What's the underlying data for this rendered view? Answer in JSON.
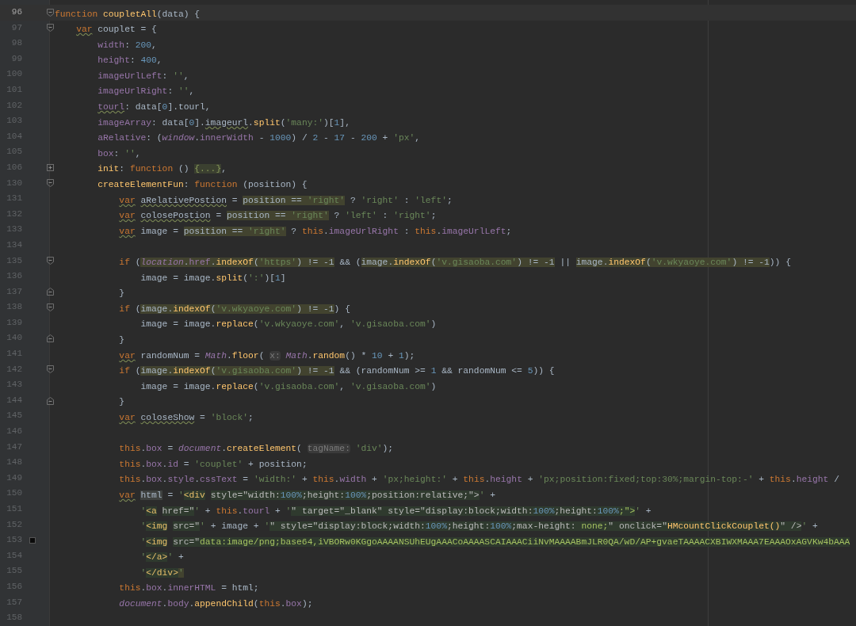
{
  "editor": {
    "lines": [
      {
        "number": "96",
        "current": true,
        "bookmark": false,
        "kind": "opener",
        "segments": [
          {
            "text": "function ",
            "kind": "keyword"
          },
          {
            "text": "coupletAll",
            "kind": "function"
          },
          {
            "text": "(data) {",
            "kind": "plain"
          }
        ]
      },
      {
        "number": "97",
        "current": false,
        "bookmark": false,
        "kind": "opener",
        "segments": [
          {
            "kind": "typo",
            "segments": [
              {
                "text": "    var",
                "kind": "keyword"
              }
            ]
          },
          {
            "text": " couplet = {",
            "kind": "plain"
          }
        ]
      },
      {
        "number": "98",
        "current": false,
        "bookmark": false,
        "segments": [
          {
            "text": "        width",
            "kind": "field"
          },
          {
            "text": ": ",
            "kind": "plain"
          },
          {
            "text": "200",
            "kind": "number"
          },
          {
            "text": ",",
            "kind": "plain"
          }
        ]
      },
      {
        "number": "99",
        "current": false,
        "bookmark": false,
        "segments": [
          {
            "text": "        height",
            "kind": "field"
          },
          {
            "text": ": ",
            "kind": "plain"
          },
          {
            "text": "400",
            "kind": "number"
          },
          {
            "text": ",",
            "kind": "plain"
          }
        ]
      },
      {
        "number": "100",
        "current": false,
        "bookmark": false,
        "segments": [
          {
            "text": "        imageUrlLeft",
            "kind": "field"
          },
          {
            "text": ": ",
            "kind": "plain"
          },
          {
            "text": "''",
            "kind": "string"
          },
          {
            "text": ",",
            "kind": "plain"
          }
        ]
      },
      {
        "number": "101",
        "current": false,
        "bookmark": false,
        "segments": [
          {
            "text": "        imageUrlRight",
            "kind": "field"
          },
          {
            "text": ": ",
            "kind": "plain"
          },
          {
            "text": "''",
            "kind": "string"
          },
          {
            "text": ",",
            "kind": "plain"
          }
        ]
      },
      {
        "number": "102",
        "current": false,
        "bookmark": false,
        "segments": [
          {
            "kind": "typo",
            "segments": [
              {
                "text": "        tourl",
                "kind": "field"
              }
            ]
          },
          {
            "text": ": data[",
            "kind": "plain"
          },
          {
            "text": "0",
            "kind": "number"
          },
          {
            "text": "].tourl,",
            "kind": "plain"
          }
        ]
      },
      {
        "number": "103",
        "current": false,
        "bookmark": false,
        "segments": [
          {
            "text": "        imageArray",
            "kind": "field"
          },
          {
            "text": ": data[",
            "kind": "plain"
          },
          {
            "text": "0",
            "kind": "number"
          },
          {
            "text": "].",
            "kind": "plain"
          },
          {
            "kind": "typo",
            "segments": [
              {
                "text": "imageurl",
                "kind": "plain"
              }
            ]
          },
          {
            "text": ".",
            "kind": "plain"
          },
          {
            "text": "split",
            "kind": "function"
          },
          {
            "text": "(",
            "kind": "plain"
          },
          {
            "text": "'many:'",
            "kind": "string"
          },
          {
            "text": ")[",
            "kind": "plain"
          },
          {
            "text": "1",
            "kind": "number"
          },
          {
            "text": "],",
            "kind": "plain"
          }
        ]
      },
      {
        "number": "104",
        "current": false,
        "bookmark": false,
        "segments": [
          {
            "text": "        aRelative",
            "kind": "field"
          },
          {
            "text": ": (",
            "kind": "plain"
          },
          {
            "text": "window",
            "kind": "global"
          },
          {
            "text": ".",
            "kind": "plain"
          },
          {
            "text": "innerWidth",
            "kind": "field"
          },
          {
            "text": " - ",
            "kind": "plain"
          },
          {
            "text": "1000",
            "kind": "number"
          },
          {
            "text": ") / ",
            "kind": "plain"
          },
          {
            "text": "2",
            "kind": "number"
          },
          {
            "text": " - ",
            "kind": "plain"
          },
          {
            "text": "17",
            "kind": "number"
          },
          {
            "text": " - ",
            "kind": "plain"
          },
          {
            "text": "200",
            "kind": "number"
          },
          {
            "text": " + ",
            "kind": "plain"
          },
          {
            "text": "'px'",
            "kind": "string"
          },
          {
            "text": ",",
            "kind": "plain"
          }
        ]
      },
      {
        "number": "105",
        "current": false,
        "bookmark": false,
        "segments": [
          {
            "text": "        box",
            "kind": "field"
          },
          {
            "text": ": ",
            "kind": "plain"
          },
          {
            "text": "''",
            "kind": "string"
          },
          {
            "text": ",",
            "kind": "plain"
          }
        ]
      },
      {
        "number": "106",
        "current": false,
        "bookmark": false,
        "kind": "collapsed",
        "segments": [
          {
            "text": "        init",
            "kind": "function"
          },
          {
            "text": ": ",
            "kind": "plain"
          },
          {
            "text": "function",
            "kind": "keyword"
          },
          {
            "text": " () ",
            "kind": "plain"
          },
          {
            "text": "{...}",
            "kind": "folded"
          },
          {
            "text": ",",
            "kind": "plain"
          }
        ]
      },
      {
        "number": "130",
        "current": false,
        "bookmark": false,
        "kind": "opener",
        "segments": [
          {
            "text": "        createElementFun",
            "kind": "function"
          },
          {
            "text": ": ",
            "kind": "plain"
          },
          {
            "text": "function",
            "kind": "keyword"
          },
          {
            "text": " (position) {",
            "kind": "plain"
          }
        ]
      },
      {
        "number": "131",
        "current": false,
        "bookmark": false,
        "segments": [
          {
            "kind": "typo",
            "segments": [
              {
                "text": "            var",
                "kind": "keyword"
              }
            ]
          },
          {
            "kind": "typo",
            "segments": [
              {
                "text": " aRelativePostion",
                "kind": "plain"
              }
            ]
          },
          {
            "text": " = ",
            "kind": "plain"
          },
          {
            "kind": "match",
            "segments": [
              {
                "text": "position == ",
                "kind": "plain"
              },
              {
                "text": "'right'",
                "kind": "string"
              }
            ]
          },
          {
            "text": " ? ",
            "kind": "plain"
          },
          {
            "text": "'right'",
            "kind": "string"
          },
          {
            "text": " : ",
            "kind": "plain"
          },
          {
            "text": "'left'",
            "kind": "string"
          },
          {
            "text": ";",
            "kind": "plain"
          }
        ]
      },
      {
        "number": "132",
        "current": false,
        "bookmark": false,
        "segments": [
          {
            "kind": "typo",
            "segments": [
              {
                "text": "            var",
                "kind": "keyword"
              }
            ]
          },
          {
            "kind": "typo",
            "segments": [
              {
                "text": " colosePostion",
                "kind": "plain"
              }
            ]
          },
          {
            "text": " = ",
            "kind": "plain"
          },
          {
            "kind": "match",
            "segments": [
              {
                "text": "position == ",
                "kind": "plain"
              },
              {
                "text": "'right'",
                "kind": "string"
              }
            ]
          },
          {
            "text": " ? ",
            "kind": "plain"
          },
          {
            "text": "'left'",
            "kind": "string"
          },
          {
            "text": " : ",
            "kind": "plain"
          },
          {
            "text": "'right'",
            "kind": "string"
          },
          {
            "text": ";",
            "kind": "plain"
          }
        ]
      },
      {
        "number": "133",
        "current": false,
        "bookmark": false,
        "segments": [
          {
            "kind": "typo",
            "segments": [
              {
                "text": "            var",
                "kind": "keyword"
              }
            ]
          },
          {
            "text": " image = ",
            "kind": "plain"
          },
          {
            "kind": "match",
            "segments": [
              {
                "text": "position == ",
                "kind": "plain"
              },
              {
                "text": "'right'",
                "kind": "string"
              }
            ]
          },
          {
            "text": " ? ",
            "kind": "plain"
          },
          {
            "text": "this",
            "kind": "keyword"
          },
          {
            "text": ".",
            "kind": "plain"
          },
          {
            "text": "imageUrlRight",
            "kind": "field"
          },
          {
            "text": " : ",
            "kind": "plain"
          },
          {
            "text": "this",
            "kind": "keyword"
          },
          {
            "text": ".",
            "kind": "plain"
          },
          {
            "text": "imageUrlLeft",
            "kind": "field"
          },
          {
            "text": ";",
            "kind": "plain"
          }
        ]
      },
      {
        "number": "134",
        "current": false,
        "bookmark": false
      },
      {
        "number": "135",
        "current": false,
        "bookmark": false,
        "kind": "opener",
        "segments": [
          {
            "text": "            if",
            "kind": "keyword"
          },
          {
            "text": " (",
            "kind": "plain"
          },
          {
            "kind": "match",
            "segments": [
              {
                "text": "location",
                "kind": "global"
              },
              {
                "text": ".",
                "kind": "plain"
              },
              {
                "text": "href",
                "kind": "field"
              },
              {
                "text": ".",
                "kind": "plain"
              },
              {
                "text": "indexOf",
                "kind": "function"
              },
              {
                "text": "(",
                "kind": "plain"
              },
              {
                "text": "'https'",
                "kind": "string"
              },
              {
                "text": ") != -1",
                "kind": "plain"
              }
            ]
          },
          {
            "text": " && (",
            "kind": "plain"
          },
          {
            "kind": "match",
            "segments": [
              {
                "text": "image.",
                "kind": "plain"
              },
              {
                "text": "indexOf",
                "kind": "function"
              },
              {
                "text": "(",
                "kind": "plain"
              },
              {
                "text": "'v.gisaoba.com'",
                "kind": "string"
              },
              {
                "text": ") != -1",
                "kind": "plain"
              }
            ]
          },
          {
            "text": " || ",
            "kind": "plain"
          },
          {
            "kind": "match",
            "segments": [
              {
                "text": "image.",
                "kind": "plain"
              },
              {
                "text": "indexOf",
                "kind": "function"
              },
              {
                "text": "(",
                "kind": "plain"
              },
              {
                "text": "'v.wkyaoye.com'",
                "kind": "string"
              },
              {
                "text": ") != -1",
                "kind": "plain"
              }
            ]
          },
          {
            "text": ")) {",
            "kind": "plain"
          }
        ]
      },
      {
        "number": "136",
        "current": false,
        "bookmark": false,
        "segments": [
          {
            "text": "                image = image.",
            "kind": "plain"
          },
          {
            "text": "split",
            "kind": "function"
          },
          {
            "text": "(",
            "kind": "plain"
          },
          {
            "text": "':'",
            "kind": "string"
          },
          {
            "text": ")[",
            "kind": "plain"
          },
          {
            "text": "1",
            "kind": "number"
          },
          {
            "text": "]",
            "kind": "plain"
          }
        ]
      },
      {
        "number": "137",
        "current": false,
        "bookmark": false,
        "kind": "closer",
        "segments": [
          {
            "text": "            }",
            "kind": "plain"
          }
        ]
      },
      {
        "number": "138",
        "current": false,
        "bookmark": false,
        "kind": "opener",
        "segments": [
          {
            "text": "            if",
            "kind": "keyword"
          },
          {
            "text": " (",
            "kind": "plain"
          },
          {
            "kind": "match",
            "segments": [
              {
                "text": "image.",
                "kind": "plain"
              },
              {
                "text": "indexOf",
                "kind": "function"
              },
              {
                "text": "(",
                "kind": "plain"
              },
              {
                "text": "'v.wkyaoye.com'",
                "kind": "string"
              },
              {
                "text": ") != -1",
                "kind": "plain"
              }
            ]
          },
          {
            "text": ") {",
            "kind": "plain"
          }
        ]
      },
      {
        "number": "139",
        "current": false,
        "bookmark": false,
        "segments": [
          {
            "text": "                image = image.",
            "kind": "plain"
          },
          {
            "text": "replace",
            "kind": "function"
          },
          {
            "text": "(",
            "kind": "plain"
          },
          {
            "text": "'v.wkyaoye.com'",
            "kind": "string"
          },
          {
            "text": ", ",
            "kind": "plain"
          },
          {
            "text": "'v.gisaoba.com'",
            "kind": "string"
          },
          {
            "text": ")",
            "kind": "plain"
          }
        ]
      },
      {
        "number": "140",
        "current": false,
        "bookmark": false,
        "kind": "closer",
        "segments": [
          {
            "text": "            }",
            "kind": "plain"
          }
        ]
      },
      {
        "number": "141",
        "current": false,
        "bookmark": false,
        "segments": [
          {
            "kind": "typo",
            "segments": [
              {
                "text": "            var",
                "kind": "keyword"
              }
            ]
          },
          {
            "text": " randomNum = ",
            "kind": "plain"
          },
          {
            "text": "Math",
            "kind": "global"
          },
          {
            "text": ".",
            "kind": "plain"
          },
          {
            "text": "floor",
            "kind": "function"
          },
          {
            "text": "( ",
            "kind": "plain"
          },
          {
            "text": "x:",
            "kind": "hint"
          },
          {
            "text": " Math",
            "kind": "global"
          },
          {
            "text": ".",
            "kind": "plain"
          },
          {
            "text": "random",
            "kind": "function"
          },
          {
            "text": "() * ",
            "kind": "plain"
          },
          {
            "text": "10",
            "kind": "number"
          },
          {
            "text": " + ",
            "kind": "plain"
          },
          {
            "text": "1",
            "kind": "number"
          },
          {
            "text": ");",
            "kind": "plain"
          }
        ]
      },
      {
        "number": "142",
        "current": false,
        "bookmark": false,
        "kind": "opener",
        "segments": [
          {
            "text": "            if",
            "kind": "keyword"
          },
          {
            "text": " (",
            "kind": "plain"
          },
          {
            "kind": "match",
            "segments": [
              {
                "text": "image.",
                "kind": "plain"
              },
              {
                "text": "indexOf",
                "kind": "function"
              },
              {
                "text": "(",
                "kind": "plain"
              },
              {
                "text": "'v.gisaoba.com'",
                "kind": "string"
              },
              {
                "text": ") != -1",
                "kind": "plain"
              }
            ]
          },
          {
            "text": " && (randomNum >= ",
            "kind": "plain"
          },
          {
            "text": "1",
            "kind": "number"
          },
          {
            "text": " && randomNum <= ",
            "kind": "plain"
          },
          {
            "text": "5",
            "kind": "number"
          },
          {
            "text": ")) {",
            "kind": "plain"
          }
        ]
      },
      {
        "number": "143",
        "current": false,
        "bookmark": false,
        "segments": [
          {
            "text": "                image = image.",
            "kind": "plain"
          },
          {
            "text": "replace",
            "kind": "function"
          },
          {
            "text": "(",
            "kind": "plain"
          },
          {
            "text": "'v.gisaoba.com'",
            "kind": "string"
          },
          {
            "text": ", ",
            "kind": "plain"
          },
          {
            "text": "'v.gisaoba.com'",
            "kind": "string"
          },
          {
            "text": ")",
            "kind": "plain"
          }
        ]
      },
      {
        "number": "144",
        "current": false,
        "bookmark": false,
        "kind": "closer",
        "segments": [
          {
            "text": "            }",
            "kind": "plain"
          }
        ]
      },
      {
        "number": "145",
        "current": false,
        "bookmark": false,
        "segments": [
          {
            "kind": "typo",
            "segments": [
              {
                "text": "            var",
                "kind": "keyword"
              }
            ]
          },
          {
            "kind": "typo",
            "segments": [
              {
                "text": " coloseShow",
                "kind": "plain"
              }
            ]
          },
          {
            "text": " = ",
            "kind": "plain"
          },
          {
            "text": "'block'",
            "kind": "string"
          },
          {
            "text": ";",
            "kind": "plain"
          }
        ]
      },
      {
        "number": "146",
        "current": false,
        "bookmark": false
      },
      {
        "number": "147",
        "current": false,
        "bookmark": false,
        "segments": [
          {
            "text": "            this",
            "kind": "keyword"
          },
          {
            "text": ".",
            "kind": "plain"
          },
          {
            "text": "box",
            "kind": "field"
          },
          {
            "text": " = ",
            "kind": "plain"
          },
          {
            "text": "document",
            "kind": "global"
          },
          {
            "text": ".",
            "kind": "plain"
          },
          {
            "text": "createElement",
            "kind": "function"
          },
          {
            "text": "( ",
            "kind": "plain"
          },
          {
            "text": "tagName:",
            "kind": "hint"
          },
          {
            "text": " 'div'",
            "kind": "string"
          },
          {
            "text": ");",
            "kind": "plain"
          }
        ]
      },
      {
        "number": "148",
        "current": false,
        "bookmark": false,
        "segments": [
          {
            "text": "            this",
            "kind": "keyword"
          },
          {
            "text": ".",
            "kind": "plain"
          },
          {
            "text": "box",
            "kind": "field"
          },
          {
            "text": ".",
            "kind": "plain"
          },
          {
            "text": "id",
            "kind": "field"
          },
          {
            "text": " = ",
            "kind": "plain"
          },
          {
            "text": "'couplet'",
            "kind": "string"
          },
          {
            "text": " + position;",
            "kind": "plain"
          }
        ]
      },
      {
        "number": "149",
        "current": false,
        "bookmark": false,
        "segments": [
          {
            "text": "            this",
            "kind": "keyword"
          },
          {
            "text": ".",
            "kind": "plain"
          },
          {
            "text": "box",
            "kind": "field"
          },
          {
            "text": ".",
            "kind": "plain"
          },
          {
            "text": "style",
            "kind": "field"
          },
          {
            "text": ".",
            "kind": "plain"
          },
          {
            "text": "cssText",
            "kind": "field"
          },
          {
            "text": " = ",
            "kind": "plain"
          },
          {
            "text": "'width:'",
            "kind": "string"
          },
          {
            "text": " + ",
            "kind": "plain"
          },
          {
            "text": "this",
            "kind": "keyword"
          },
          {
            "text": ".",
            "kind": "plain"
          },
          {
            "text": "width",
            "kind": "field"
          },
          {
            "text": " + ",
            "kind": "plain"
          },
          {
            "text": "'px;height:'",
            "kind": "string"
          },
          {
            "text": " + ",
            "kind": "plain"
          },
          {
            "text": "this",
            "kind": "keyword"
          },
          {
            "text": ".",
            "kind": "plain"
          },
          {
            "text": "height",
            "kind": "field"
          },
          {
            "text": " + ",
            "kind": "plain"
          },
          {
            "text": "'px;position:fixed;top:30%;margin-top:-'",
            "kind": "string"
          },
          {
            "text": " + ",
            "kind": "plain"
          },
          {
            "text": "this",
            "kind": "keyword"
          },
          {
            "text": ".",
            "kind": "plain"
          },
          {
            "text": "height",
            "kind": "field"
          },
          {
            "text": " /",
            "kind": "plain"
          }
        ]
      },
      {
        "number": "150",
        "current": false,
        "bookmark": false,
        "segments": [
          {
            "kind": "typo",
            "segments": [
              {
                "text": "            var",
                "kind": "keyword"
              }
            ]
          },
          {
            "kind": "caret",
            "segments": [
              {
                "text": " html",
                "kind": "plain"
              }
            ]
          },
          {
            "text": " = ",
            "kind": "plain"
          },
          {
            "text": "'",
            "kind": "string"
          },
          {
            "kind": "inject",
            "segments": [
              {
                "text": "<div",
                "kind": "tag"
              },
              {
                "text": " style=\"width:",
                "kind": "attribute"
              },
              {
                "text": "100%",
                "kind": "number"
              },
              {
                "text": ";height:",
                "kind": "attribute"
              },
              {
                "text": "100%",
                "kind": "number"
              },
              {
                "text": ";position:relative;\">",
                "kind": "attribute"
              }
            ]
          },
          {
            "text": "'",
            "kind": "string"
          },
          {
            "text": " +",
            "kind": "plain"
          }
        ]
      },
      {
        "number": "151",
        "current": false,
        "bookmark": false,
        "segments": [
          {
            "text": "                '",
            "kind": "string"
          },
          {
            "kind": "inject",
            "segments": [
              {
                "text": "<a",
                "kind": "tag"
              },
              {
                "text": " href=\"",
                "kind": "attribute"
              }
            ]
          },
          {
            "text": "'",
            "kind": "string"
          },
          {
            "text": " + ",
            "kind": "plain"
          },
          {
            "text": "this",
            "kind": "keyword"
          },
          {
            "text": ".",
            "kind": "plain"
          },
          {
            "text": "tourl",
            "kind": "field"
          },
          {
            "text": " + ",
            "kind": "plain"
          },
          {
            "text": "'",
            "kind": "string"
          },
          {
            "kind": "inject",
            "segments": [
              {
                "text": "\" target=\"_blank\" style=\"display:block;width:",
                "kind": "attribute"
              },
              {
                "text": "100%",
                "kind": "number"
              },
              {
                "text": ";height:",
                "kind": "attribute"
              },
              {
                "text": "100%",
                "kind": "number"
              },
              {
                "text": ";\">",
                "kind": "value"
              }
            ]
          },
          {
            "text": "'",
            "kind": "string"
          },
          {
            "text": " +",
            "kind": "plain"
          }
        ]
      },
      {
        "number": "152",
        "current": false,
        "bookmark": false,
        "segments": [
          {
            "text": "                '",
            "kind": "string"
          },
          {
            "kind": "inject",
            "segments": [
              {
                "text": "<img",
                "kind": "tag"
              },
              {
                "text": " src=\"",
                "kind": "attribute"
              }
            ]
          },
          {
            "text": "'",
            "kind": "string"
          },
          {
            "text": " + image + ",
            "kind": "plain"
          },
          {
            "text": "'",
            "kind": "string"
          },
          {
            "kind": "inject",
            "segments": [
              {
                "text": "\" style=\"display:block;width:",
                "kind": "attribute"
              },
              {
                "text": "100%",
                "kind": "number"
              },
              {
                "text": ";height:",
                "kind": "attribute"
              },
              {
                "text": "100%",
                "kind": "number"
              },
              {
                "text": ";max-height: ",
                "kind": "attribute"
              },
              {
                "text": "none;",
                "kind": "value"
              },
              {
                "text": "\" onclick=\"",
                "kind": "attribute"
              },
              {
                "text": "HMcountClickCouplet()",
                "kind": "function"
              },
              {
                "text": "\" />",
                "kind": "attribute"
              }
            ]
          },
          {
            "text": "'",
            "kind": "string"
          },
          {
            "text": " +",
            "kind": "plain"
          }
        ]
      },
      {
        "number": "153",
        "current": false,
        "bookmark": true,
        "segments": [
          {
            "text": "                '",
            "kind": "string"
          },
          {
            "kind": "inject",
            "segments": [
              {
                "text": "<img",
                "kind": "tag"
              },
              {
                "text": " src=\"",
                "kind": "attribute"
              },
              {
                "text": "data:image/png;base64,iVBORw0KGgoAAAANSUhEUgAAACoAAAASCAIAAACiiNvMAAAABmJLR0QA/wD/AP+gvaeTAAAACXBIWXMAAA7EAAAOxAGVKw4bAAA",
                "kind": "value"
              }
            ]
          }
        ]
      },
      {
        "number": "154",
        "current": false,
        "bookmark": false,
        "segments": [
          {
            "text": "                '",
            "kind": "string"
          },
          {
            "kind": "inject",
            "segments": [
              {
                "text": "</a>",
                "kind": "tag"
              }
            ]
          },
          {
            "text": "'",
            "kind": "string"
          },
          {
            "text": " +",
            "kind": "plain"
          }
        ]
      },
      {
        "number": "155",
        "current": false,
        "bookmark": false,
        "segments": [
          {
            "text": "                '",
            "kind": "string"
          },
          {
            "kind": "inject",
            "segments": [
              {
                "text": "</div>",
                "kind": "tag"
              }
            ]
          },
          {
            "kind": "match",
            "segments": [
              {
                "text": "'",
                "kind": "string"
              }
            ]
          }
        ]
      },
      {
        "number": "156",
        "current": false,
        "bookmark": false,
        "segments": [
          {
            "text": "            this",
            "kind": "keyword"
          },
          {
            "text": ".",
            "kind": "plain"
          },
          {
            "text": "box",
            "kind": "field"
          },
          {
            "text": ".",
            "kind": "plain"
          },
          {
            "text": "innerHTML",
            "kind": "field"
          },
          {
            "text": " = html;",
            "kind": "plain"
          }
        ]
      },
      {
        "number": "157",
        "current": false,
        "bookmark": false,
        "segments": [
          {
            "text": "            document",
            "kind": "global"
          },
          {
            "text": ".",
            "kind": "plain"
          },
          {
            "text": "body",
            "kind": "field"
          },
          {
            "text": ".",
            "kind": "plain"
          },
          {
            "text": "appendChild",
            "kind": "function"
          },
          {
            "text": "(",
            "kind": "plain"
          },
          {
            "text": "this",
            "kind": "keyword"
          },
          {
            "text": ".",
            "kind": "plain"
          },
          {
            "text": "box",
            "kind": "field"
          },
          {
            "text": ");",
            "kind": "plain"
          }
        ]
      },
      {
        "number": "158",
        "current": false,
        "bookmark": false
      }
    ]
  }
}
